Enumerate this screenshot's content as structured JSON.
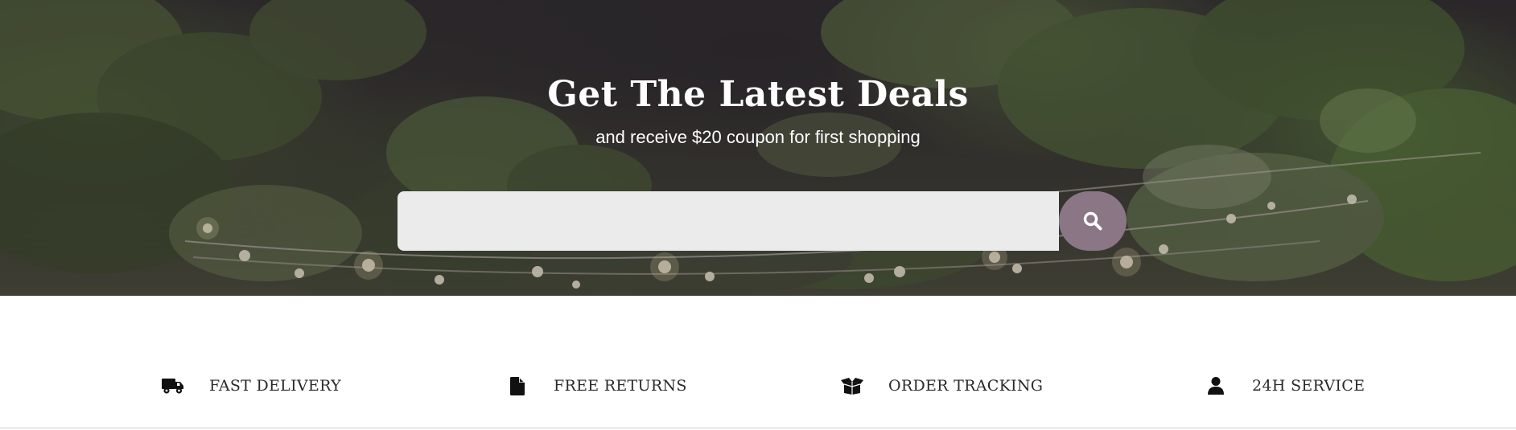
{
  "hero": {
    "title": "Get The Latest Deals",
    "subtitle": "and receive $20 coupon for first shopping",
    "search_value": "",
    "search_button_icon": "search-icon",
    "search_button_color": "#8a7685"
  },
  "features": [
    {
      "icon": "truck-icon",
      "label": "FAST DELIVERY"
    },
    {
      "icon": "file-icon",
      "label": "FREE RETURNS"
    },
    {
      "icon": "open-box-icon",
      "label": "ORDER TRACKING"
    },
    {
      "icon": "user-icon",
      "label": "24H SERVICE"
    }
  ]
}
